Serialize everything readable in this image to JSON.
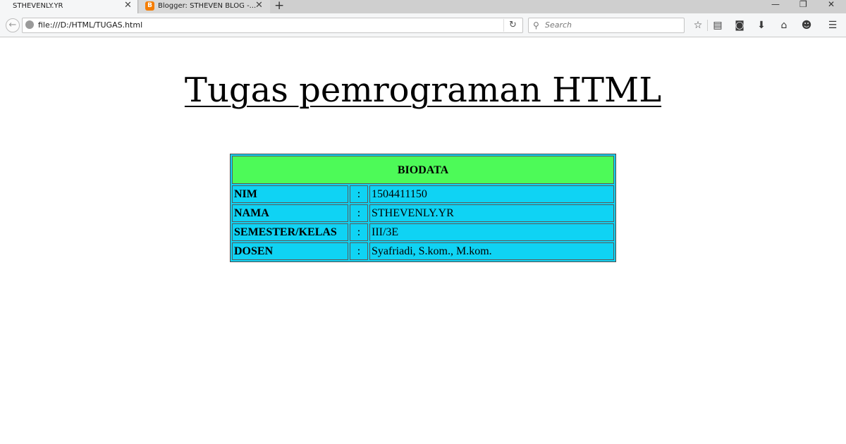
{
  "tabs": [
    {
      "title": "STHEVENLY.YR",
      "active": true
    },
    {
      "title": "Blogger: STHEVEN BLOG -...",
      "active": false,
      "favicon": "B"
    }
  ],
  "window_controls": {
    "minimize": "—",
    "restore": "❐",
    "close": "✕"
  },
  "nav": {
    "url": "file:///D:/HTML/TUGAS.html",
    "search_placeholder": "Search"
  },
  "page": {
    "title": "Tugas pemrograman HTML",
    "table": {
      "header": "BIODATA",
      "separator": ":",
      "rows": [
        {
          "label": "NIM",
          "value": "1504411150"
        },
        {
          "label": "NAMA",
          "value": "STHEVENLY.YR"
        },
        {
          "label": "SEMESTER/KELAS",
          "value": "III/3E"
        },
        {
          "label": "DOSEN",
          "value": "Syafriadi, S.kom., M.kom."
        }
      ]
    }
  },
  "colors": {
    "header_bg": "#4dfa58",
    "table_bg": "#0fd3f4"
  },
  "icons": [
    "back-icon",
    "globe-icon",
    "reload-icon",
    "search-icon",
    "bookmark-star-icon",
    "reader-view-icon",
    "pocket-icon",
    "download-icon",
    "home-icon",
    "hello-icon",
    "menu-icon"
  ]
}
